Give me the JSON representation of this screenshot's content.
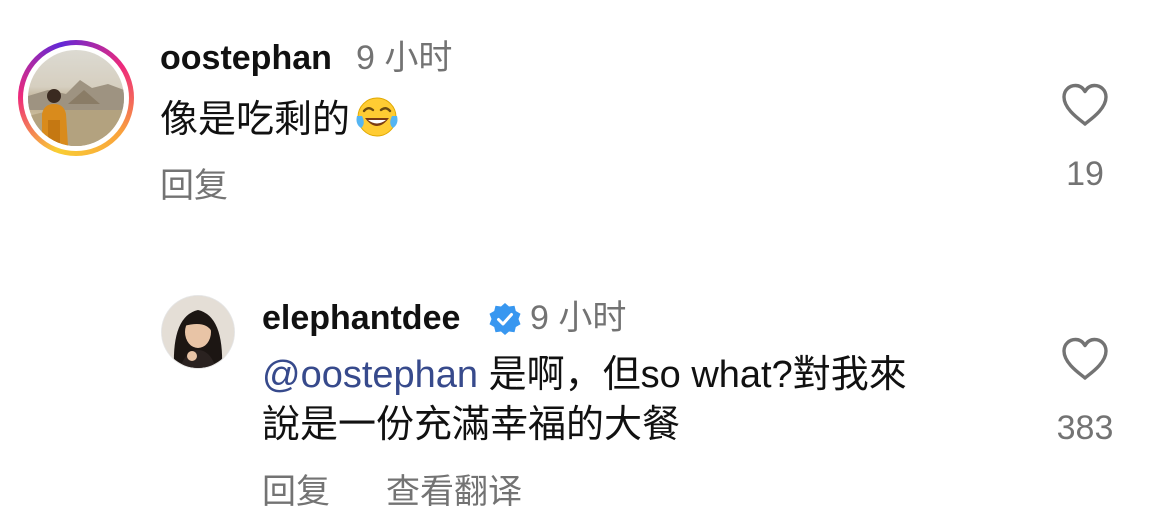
{
  "comments": [
    {
      "username": "oostephan",
      "time": "9 小时",
      "text": "像是吃剩的",
      "emoji": "face-with-tears-of-joy",
      "reply_label": "回复",
      "like_count": "19",
      "avatar_story_ring": true
    },
    {
      "username": "elephantdee",
      "verified": true,
      "time": "9 小时",
      "mention": "@oostephan",
      "text_line1": " 是啊，但so what?對我來",
      "text_line2": "說是一份充滿幸福的大餐",
      "reply_label": "回复",
      "translate_label": "查看翻译",
      "like_count": "383"
    }
  ],
  "icons": {
    "like": "heart-outline-icon",
    "verified": "verified-badge-icon"
  },
  "colors": {
    "username": "#111111",
    "meta": "#737373",
    "mention": "#374a8c",
    "verified": "#3897f0",
    "background": "#ffffff"
  }
}
